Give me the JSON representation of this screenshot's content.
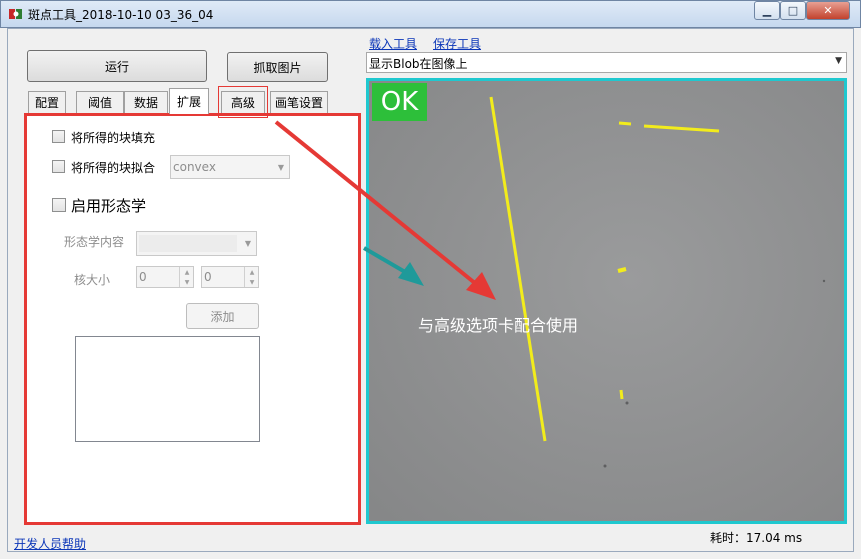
{
  "window": {
    "title": "斑点工具_2018-10-10 03_36_04",
    "minimize_glyph": "▁",
    "maximize_glyph": "□",
    "close_glyph": "✕"
  },
  "toolbar": {
    "run_label": "运行",
    "grab_label": "抓取图片",
    "load_tool_label": "载入工具",
    "save_tool_label": "保存工具"
  },
  "tabs": [
    {
      "label": "配置"
    },
    {
      "label": "阈值"
    },
    {
      "label": "数据"
    },
    {
      "label": "扩展"
    },
    {
      "label": "高级"
    },
    {
      "label": "画笔设置"
    }
  ],
  "active_tab": "扩展",
  "extend_panel": {
    "fill_blobs_label": "将所得的块填充",
    "fit_blobs_label": "将所得的块拟合",
    "fit_mode_value": "convex",
    "enable_morphology_label": "启用形态学",
    "morphology_content_label": "形态学内容",
    "kernel_size_label": "核大小",
    "kernel_x_value": "0",
    "kernel_y_value": "0",
    "add_label": "添加"
  },
  "display_mode": {
    "selected": "显示Blob在图像上"
  },
  "image": {
    "status_text": "OK",
    "annotation_text": "与高级选项卡配合使用"
  },
  "footer": {
    "help_link": "开发人员帮助",
    "elapsed_text": "耗时：17.04 ms"
  },
  "colors": {
    "accent_cyan": "#1fc8cf",
    "ok_green": "#2dbf3a",
    "highlight_red": "#e53935",
    "blob_yellow": "#f2ec1c",
    "arrow_teal": "#1f9a9a"
  }
}
